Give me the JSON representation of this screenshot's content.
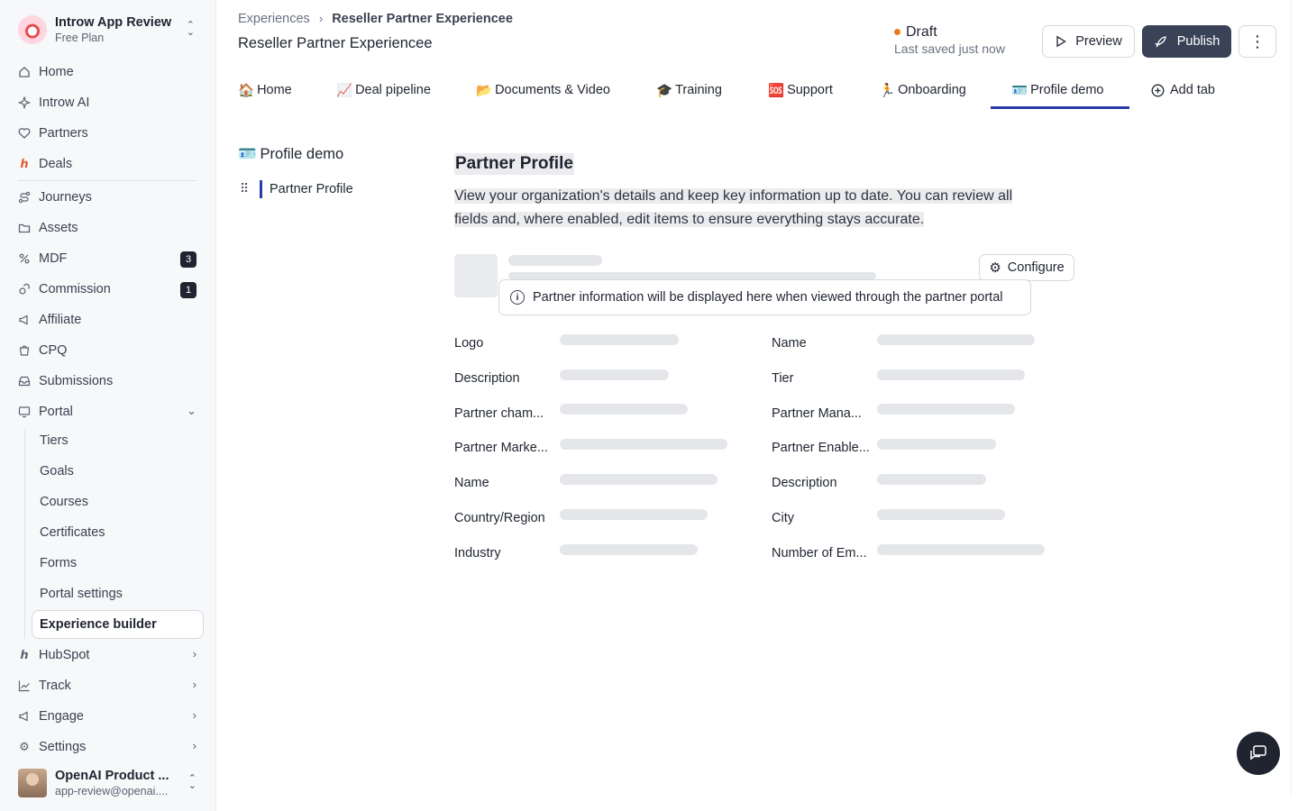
{
  "org": {
    "name": "Introw App Review",
    "plan": "Free Plan"
  },
  "nav": [
    {
      "label": "Home",
      "icon": "home-icon"
    },
    {
      "label": "Introw AI",
      "icon": "sparkle-icon"
    },
    {
      "label": "Partners",
      "icon": "handshake-icon"
    },
    {
      "label": "Deals",
      "icon": "hubspot-icon"
    },
    {
      "label": "Journeys",
      "icon": "route-icon"
    },
    {
      "label": "Assets",
      "icon": "folder-icon"
    },
    {
      "label": "MDF",
      "icon": "percent-icon",
      "badge": "3"
    },
    {
      "label": "Commission",
      "icon": "coins-icon",
      "badge": "1"
    },
    {
      "label": "Affiliate",
      "icon": "megaphone-icon"
    },
    {
      "label": "CPQ",
      "icon": "cart-icon"
    },
    {
      "label": "Submissions",
      "icon": "inbox-icon"
    },
    {
      "label": "Portal",
      "icon": "monitor-icon"
    }
  ],
  "portal_sub": [
    "Tiers",
    "Goals",
    "Courses",
    "Certificates",
    "Forms",
    "Portal settings",
    "Experience builder"
  ],
  "nav_bottom": [
    {
      "label": "HubSpot",
      "icon": "hubspot-icon"
    },
    {
      "label": "Track",
      "icon": "chart-icon"
    },
    {
      "label": "Engage",
      "icon": "megaphone-icon"
    },
    {
      "label": "Settings",
      "icon": "gear-icon"
    }
  ],
  "user": {
    "name": "OpenAI Product ...",
    "email": "app-review@openai...."
  },
  "breadcrumb": {
    "parent": "Experiences",
    "current": "Reseller Partner Experiencee"
  },
  "page_title": "Reseller Partner Experiencee",
  "status": {
    "label": "Draft",
    "saved": "Last saved just now",
    "color": "#f07a1a"
  },
  "actions": {
    "preview": "Preview",
    "publish": "Publish"
  },
  "tabs": [
    {
      "emoji": "🏠",
      "label": "Home"
    },
    {
      "emoji": "📈",
      "label": "Deal pipeline"
    },
    {
      "emoji": "📂",
      "label": "Documents & Video"
    },
    {
      "emoji": "🎓",
      "label": "Training"
    },
    {
      "emoji": "🆘",
      "label": "Support"
    },
    {
      "emoji": "🏃",
      "label": "Onboarding"
    },
    {
      "emoji": "🪪",
      "label": "Profile demo"
    },
    {
      "emoji": "",
      "label": "Add tab"
    }
  ],
  "section": {
    "title": "Profile demo",
    "emoji": "🪪",
    "item": "Partner Profile"
  },
  "content": {
    "title": "Partner Profile",
    "description_line1": "View your organization's details and keep key information up to date. You can review all",
    "description_line2": "fields and, where enabled, edit items to ensure everything stays accurate.",
    "configure": "Configure",
    "notice": "Partner information will be displayed here when viewed through the partner portal"
  },
  "fields_left": [
    "Logo",
    "Description",
    "Partner cham...",
    "Partner Marke...",
    "Name",
    "Country/Region",
    "Industry"
  ],
  "fields_right": [
    "Name",
    "Tier",
    "Partner Mana...",
    "Partner Enable...",
    "Description",
    "City",
    "Number of Em..."
  ],
  "accent": "#2b3baa"
}
